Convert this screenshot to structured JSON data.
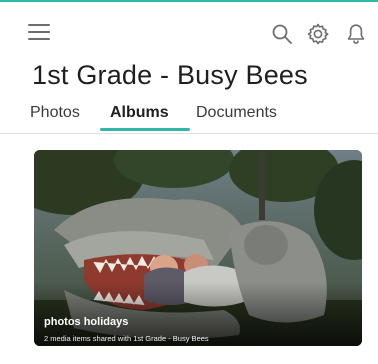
{
  "header": {
    "title": "1st Grade - Busy Bees",
    "icons": [
      "menu-icon",
      "search-icon",
      "settings-icon",
      "bell-icon"
    ],
    "accent_color": "#2fb7a8"
  },
  "tabs": [
    {
      "label": "Photos",
      "active": false
    },
    {
      "label": "Albums",
      "active": true
    },
    {
      "label": "Documents",
      "active": false
    }
  ],
  "albums": [
    {
      "name": "photos holidays",
      "subtitle": "2 media items shared with 1st Grade - Busy Bees"
    }
  ]
}
